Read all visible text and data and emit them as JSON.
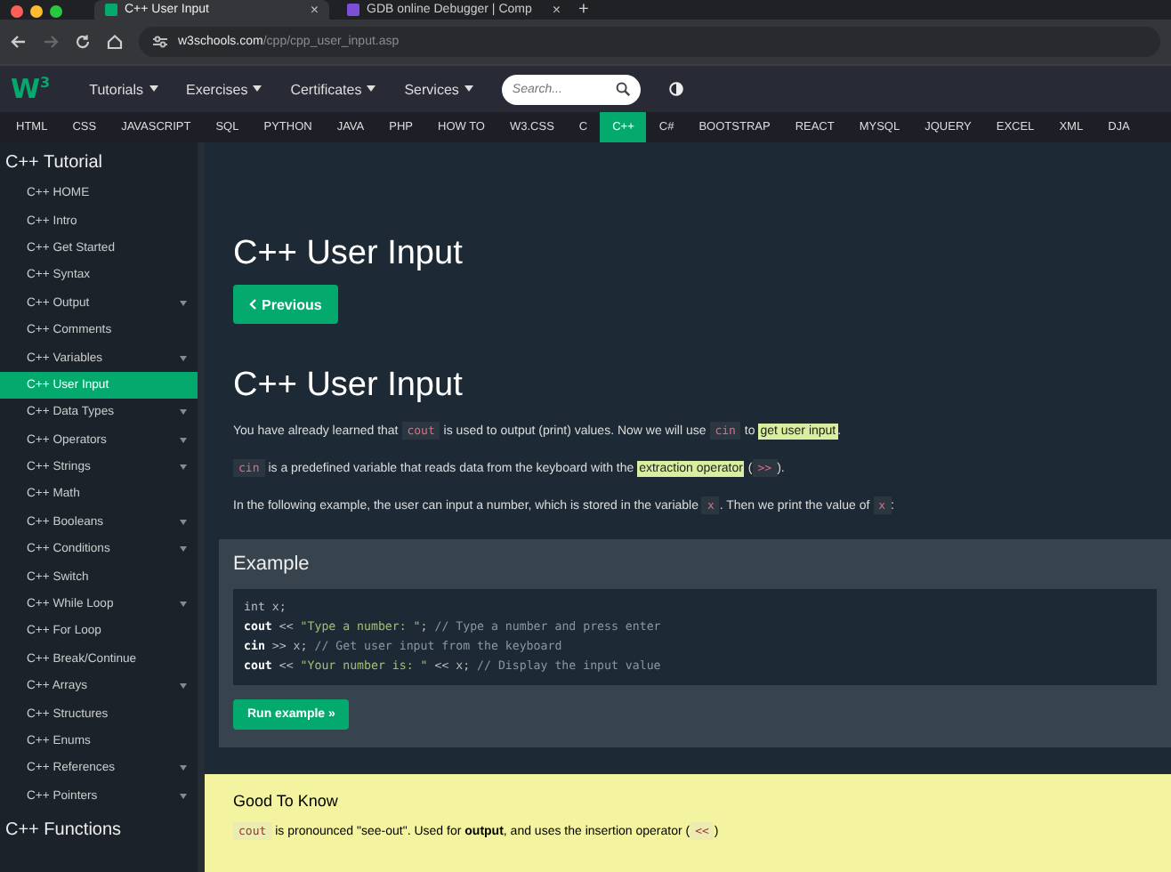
{
  "browser": {
    "tabs": [
      {
        "title": "C++ User Input",
        "close": "×",
        "selected": true
      },
      {
        "title": "GDB online Debugger | Comp",
        "close": "×",
        "selected": false
      }
    ],
    "new_tab": "+",
    "address": {
      "host": "w3schools.com",
      "path": "/cpp/cpp_user_input.asp"
    }
  },
  "navbar": {
    "logo": "W$^{3}$",
    "menus": [
      "Tutorials",
      "Exercises",
      "Certificates",
      "Services"
    ],
    "search": {
      "placeholder": "Search..."
    }
  },
  "subjects": [
    {
      "label": "HTML",
      "selected": false
    },
    {
      "label": "CSS",
      "selected": false
    },
    {
      "label": "JAVASCRIPT",
      "selected": false
    },
    {
      "label": "SQL",
      "selected": false
    },
    {
      "label": "PYTHON",
      "selected": false
    },
    {
      "label": "JAVA",
      "selected": false
    },
    {
      "label": "PHP",
      "selected": false
    },
    {
      "label": "HOW TO",
      "selected": false
    },
    {
      "label": "W3.CSS",
      "selected": false
    },
    {
      "label": "C",
      "selected": false
    },
    {
      "label": "C++",
      "selected": true
    },
    {
      "label": "C#",
      "selected": false
    },
    {
      "label": "BOOTSTRAP",
      "selected": false
    },
    {
      "label": "REACT",
      "selected": false
    },
    {
      "label": "MYSQL",
      "selected": false
    },
    {
      "label": "JQUERY",
      "selected": false
    },
    {
      "label": "EXCEL",
      "selected": false
    },
    {
      "label": "XML",
      "selected": false
    },
    {
      "label": "DJA",
      "selected": false
    }
  ],
  "sidebar": {
    "heading": "C++ Tutorial",
    "items": [
      {
        "label": "C++ HOME",
        "expandable": false,
        "selected": false
      },
      {
        "label": "C++ Intro",
        "expandable": false,
        "selected": false
      },
      {
        "label": "C++ Get Started",
        "expandable": false,
        "selected": false
      },
      {
        "label": "C++ Syntax",
        "expandable": false,
        "selected": false
      },
      {
        "label": "C++ Output",
        "expandable": true,
        "selected": false
      },
      {
        "label": "C++ Comments",
        "expandable": false,
        "selected": false
      },
      {
        "label": "C++ Variables",
        "expandable": true,
        "selected": false
      },
      {
        "label": "C++ User Input",
        "expandable": false,
        "selected": true
      },
      {
        "label": "C++ Data Types",
        "expandable": true,
        "selected": false
      },
      {
        "label": "C++ Operators",
        "expandable": true,
        "selected": false
      },
      {
        "label": "C++ Strings",
        "expandable": true,
        "selected": false
      },
      {
        "label": "C++ Math",
        "expandable": false,
        "selected": false
      },
      {
        "label": "C++ Booleans",
        "expandable": true,
        "selected": false
      },
      {
        "label": "C++ Conditions",
        "expandable": true,
        "selected": false
      },
      {
        "label": "C++ Switch",
        "expandable": false,
        "selected": false
      },
      {
        "label": "C++ While Loop",
        "expandable": true,
        "selected": false
      },
      {
        "label": "C++ For Loop",
        "expandable": false,
        "selected": false
      },
      {
        "label": "C++ Break/Continue",
        "expandable": false,
        "selected": false
      },
      {
        "label": "C++ Arrays",
        "expandable": true,
        "selected": false
      },
      {
        "label": "C++ Structures",
        "expandable": false,
        "selected": false
      },
      {
        "label": "C++ Enums",
        "expandable": false,
        "selected": false
      },
      {
        "label": "C++ References",
        "expandable": true,
        "selected": false
      },
      {
        "label": "C++ Pointers",
        "expandable": true,
        "selected": false
      }
    ],
    "next_heading": "C++ Functions"
  },
  "main": {
    "title": "C++ User Input",
    "previous_button": "Previous",
    "heading": "C++ User Input",
    "paragraphs": [
      [
        {
          "kind": "text",
          "text": "You have already learned that "
        },
        {
          "kind": "code",
          "text": "cout"
        },
        {
          "kind": "text",
          "text": " is used to output (print) values. Now we will use "
        },
        {
          "kind": "code",
          "text": "cin"
        },
        {
          "kind": "text",
          "text": " to "
        },
        {
          "kind": "link",
          "text": "get user input"
        },
        {
          "kind": "text",
          "text": "."
        }
      ],
      [
        {
          "kind": "code",
          "text": "cin"
        },
        {
          "kind": "text",
          "text": " is a predefined variable that reads data from the keyboard with the "
        },
        {
          "kind": "link",
          "text": "extraction operator"
        },
        {
          "kind": "text",
          "text": " ("
        },
        {
          "kind": "code",
          "text": ">>"
        },
        {
          "kind": "text",
          "text": ")."
        }
      ],
      [
        {
          "kind": "text",
          "text": "In the following example, the user can input a number, which is stored in the variable "
        },
        {
          "kind": "code",
          "text": "x"
        },
        {
          "kind": "text",
          "text": ". Then we print the value of "
        },
        {
          "kind": "code",
          "text": "x"
        },
        {
          "kind": "text",
          "text": ":"
        }
      ]
    ],
    "example": {
      "title": "Example",
      "code": [
        [
          {
            "kind": "plain",
            "text": "int x;"
          }
        ],
        [
          {
            "kind": "kw",
            "text": "cout"
          },
          {
            "kind": "plain",
            "text": " << "
          },
          {
            "kind": "str",
            "text": "\"Type a number: \""
          },
          {
            "kind": "plain",
            "text": "; "
          },
          {
            "kind": "comment",
            "text": "// Type a number and press enter"
          }
        ],
        [
          {
            "kind": "kw",
            "text": "cin"
          },
          {
            "kind": "plain",
            "text": " >> x; "
          },
          {
            "kind": "comment",
            "text": "// Get user input from the keyboard"
          }
        ],
        [
          {
            "kind": "kw",
            "text": "cout"
          },
          {
            "kind": "plain",
            "text": " << "
          },
          {
            "kind": "str",
            "text": "\"Your number is: \""
          },
          {
            "kind": "plain",
            "text": " << x; "
          },
          {
            "kind": "comment",
            "text": "// Display the input value"
          }
        ]
      ],
      "run_button": "Run example »"
    },
    "note": {
      "title": "Good To Know",
      "text": [
        {
          "kind": "code",
          "text": "cout"
        },
        {
          "kind": "text",
          "text": " is pronounced \"see-out\". Used for "
        },
        {
          "kind": "bold",
          "text": "output"
        },
        {
          "kind": "text",
          "text": ", and uses the insertion operator ("
        },
        {
          "kind": "code",
          "text": "<<"
        },
        {
          "kind": "text",
          "text": ")"
        }
      ]
    }
  }
}
